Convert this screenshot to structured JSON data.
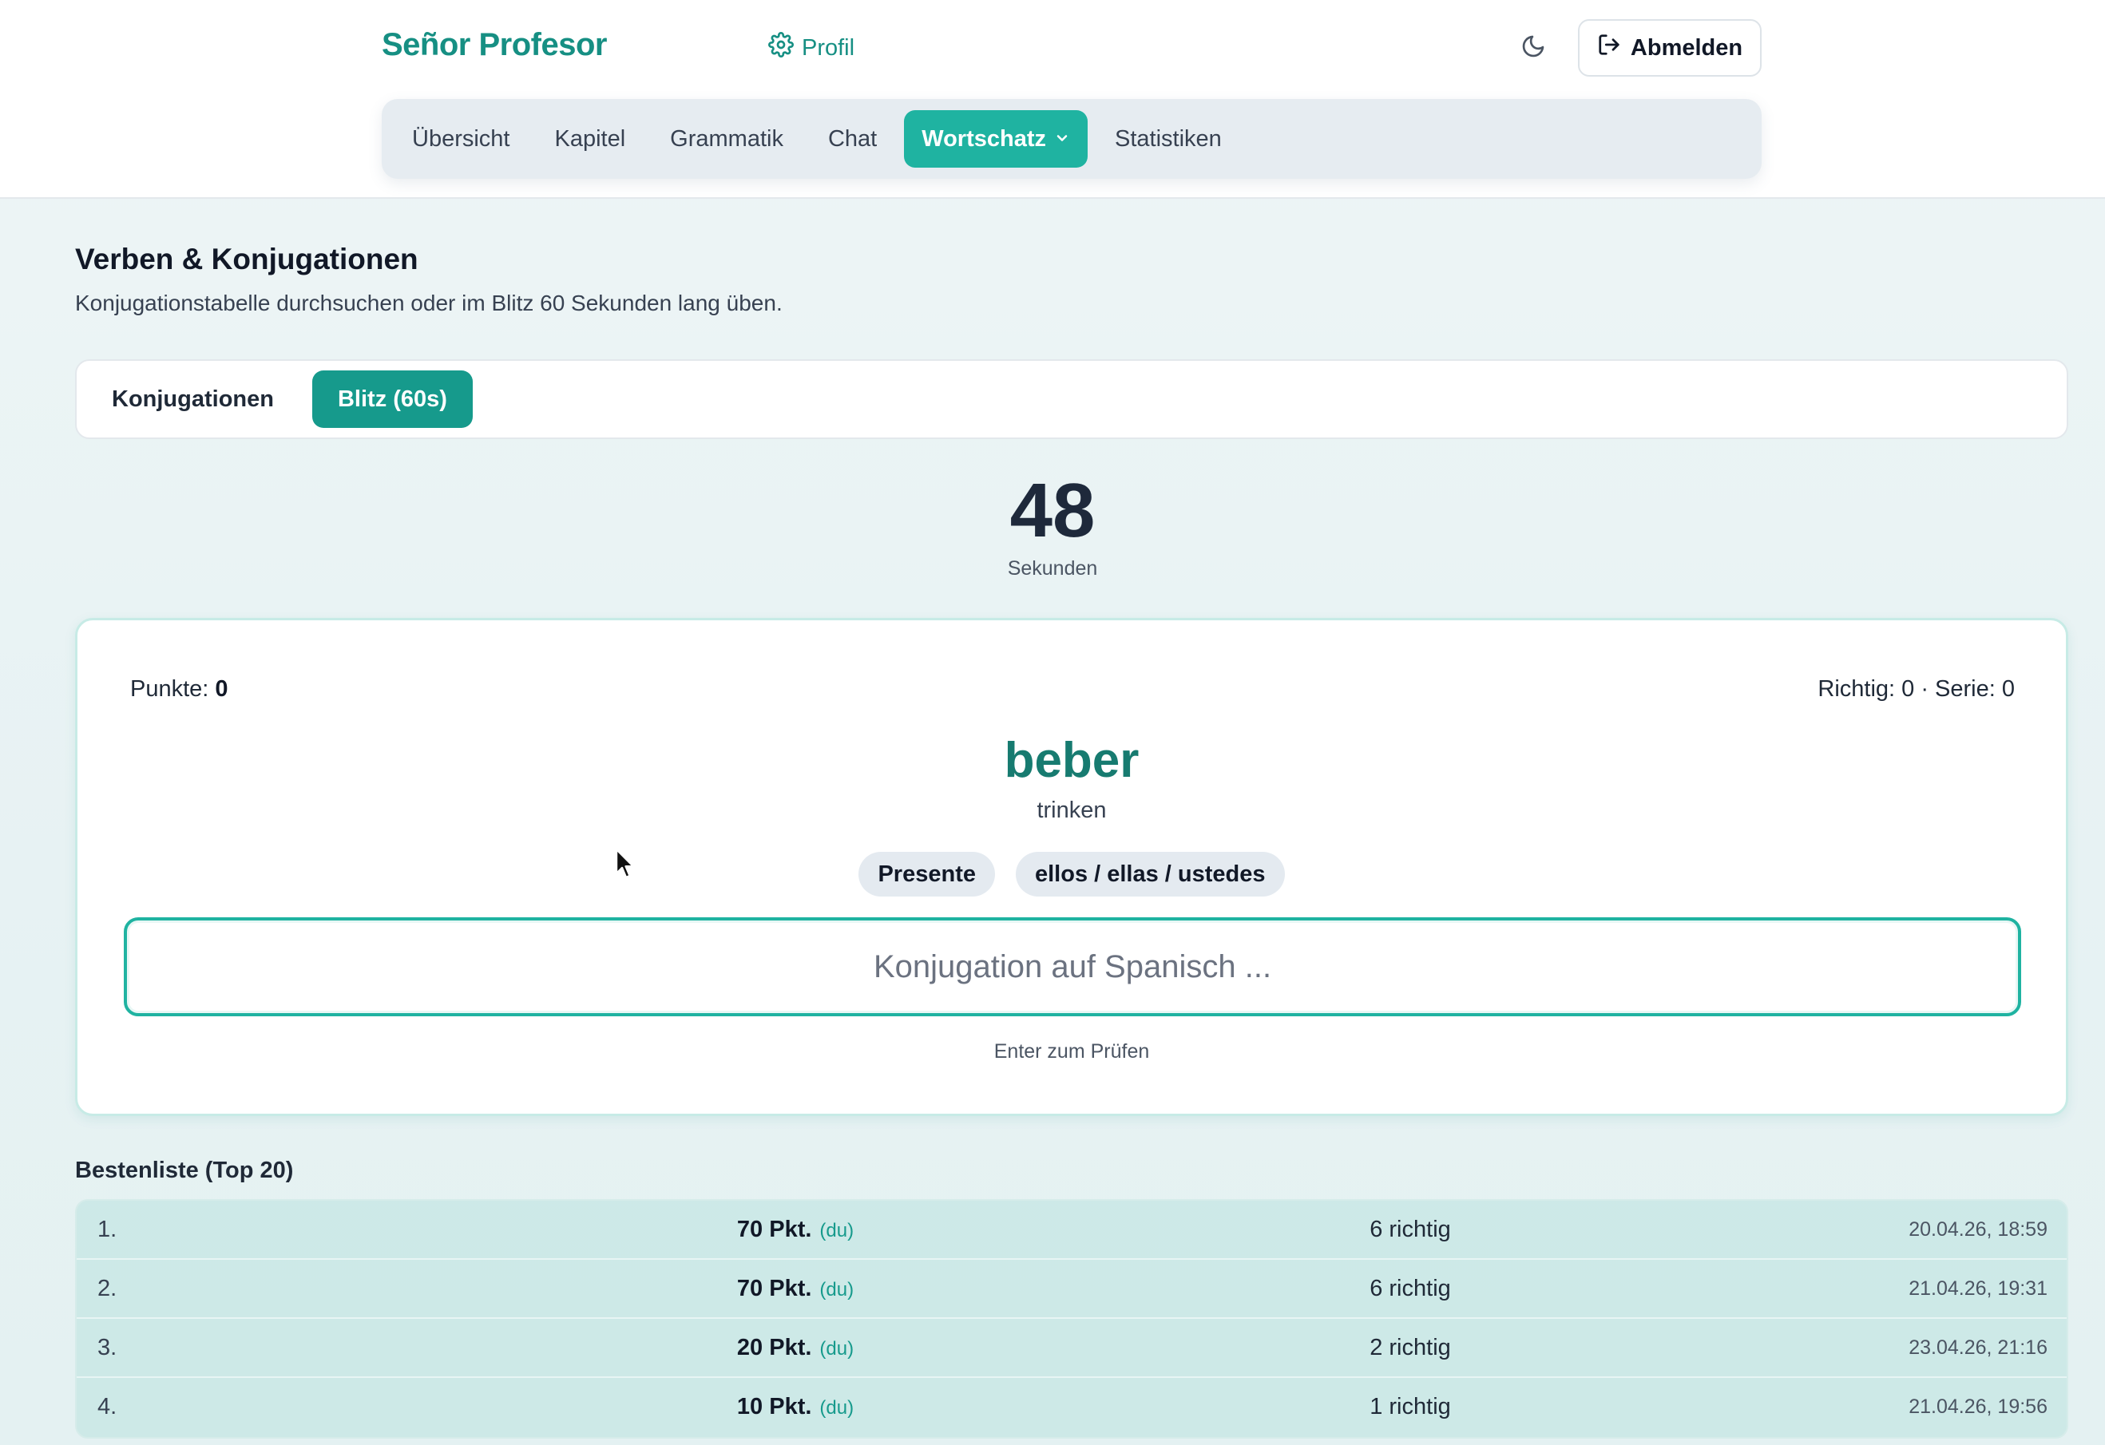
{
  "header": {
    "brand": "Señor Profesor",
    "profile_link": "Profil",
    "logout_label": "Abmelden"
  },
  "nav": {
    "items": [
      {
        "label": "Übersicht"
      },
      {
        "label": "Kapitel"
      },
      {
        "label": "Grammatik"
      },
      {
        "label": "Chat"
      },
      {
        "label": "Wortschatz",
        "active": true
      },
      {
        "label": "Statistiken"
      }
    ]
  },
  "page": {
    "title": "Verben & Konjugationen",
    "subtitle": "Konjugationstabelle durchsuchen oder im Blitz 60 Sekunden lang üben."
  },
  "tabs": [
    {
      "label": "Konjugationen"
    },
    {
      "label": "Blitz (60s)",
      "active": true
    }
  ],
  "timer": {
    "value": "48",
    "label": "Sekunden"
  },
  "quiz": {
    "points_label": "Punkte:",
    "points_value": "0",
    "stats": "Richtig: 0 · Serie: 0",
    "verb": "beber",
    "translation": "trinken",
    "tense": "Presente",
    "person": "ellos / ellas / ustedes",
    "input_placeholder": "Konjugation auf Spanisch ...",
    "input_value": "",
    "hint": "Enter zum Prüfen"
  },
  "leaderboard": {
    "title": "Bestenliste (Top 20)",
    "rows": [
      {
        "rank": "1.",
        "points": "70 Pkt.",
        "you": "(du)",
        "correct": "6 richtig",
        "date": "20.04.26, 18:59"
      },
      {
        "rank": "2.",
        "points": "70 Pkt.",
        "you": "(du)",
        "correct": "6 richtig",
        "date": "21.04.26, 19:31"
      },
      {
        "rank": "3.",
        "points": "20 Pkt.",
        "you": "(du)",
        "correct": "2 richtig",
        "date": "23.04.26, 21:16"
      },
      {
        "rank": "4.",
        "points": "10 Pkt.",
        "you": "(du)",
        "correct": "1 richtig",
        "date": "21.04.26, 19:56"
      }
    ]
  },
  "colors": {
    "accent": "#1fb3a1",
    "accent_dark": "#169a8c",
    "brand": "#168f83",
    "verb": "#177b70"
  },
  "icons": {
    "profile": "gear-icon",
    "theme": "moon-icon",
    "logout": "logout-icon",
    "dropdown": "chevron-down-icon"
  }
}
